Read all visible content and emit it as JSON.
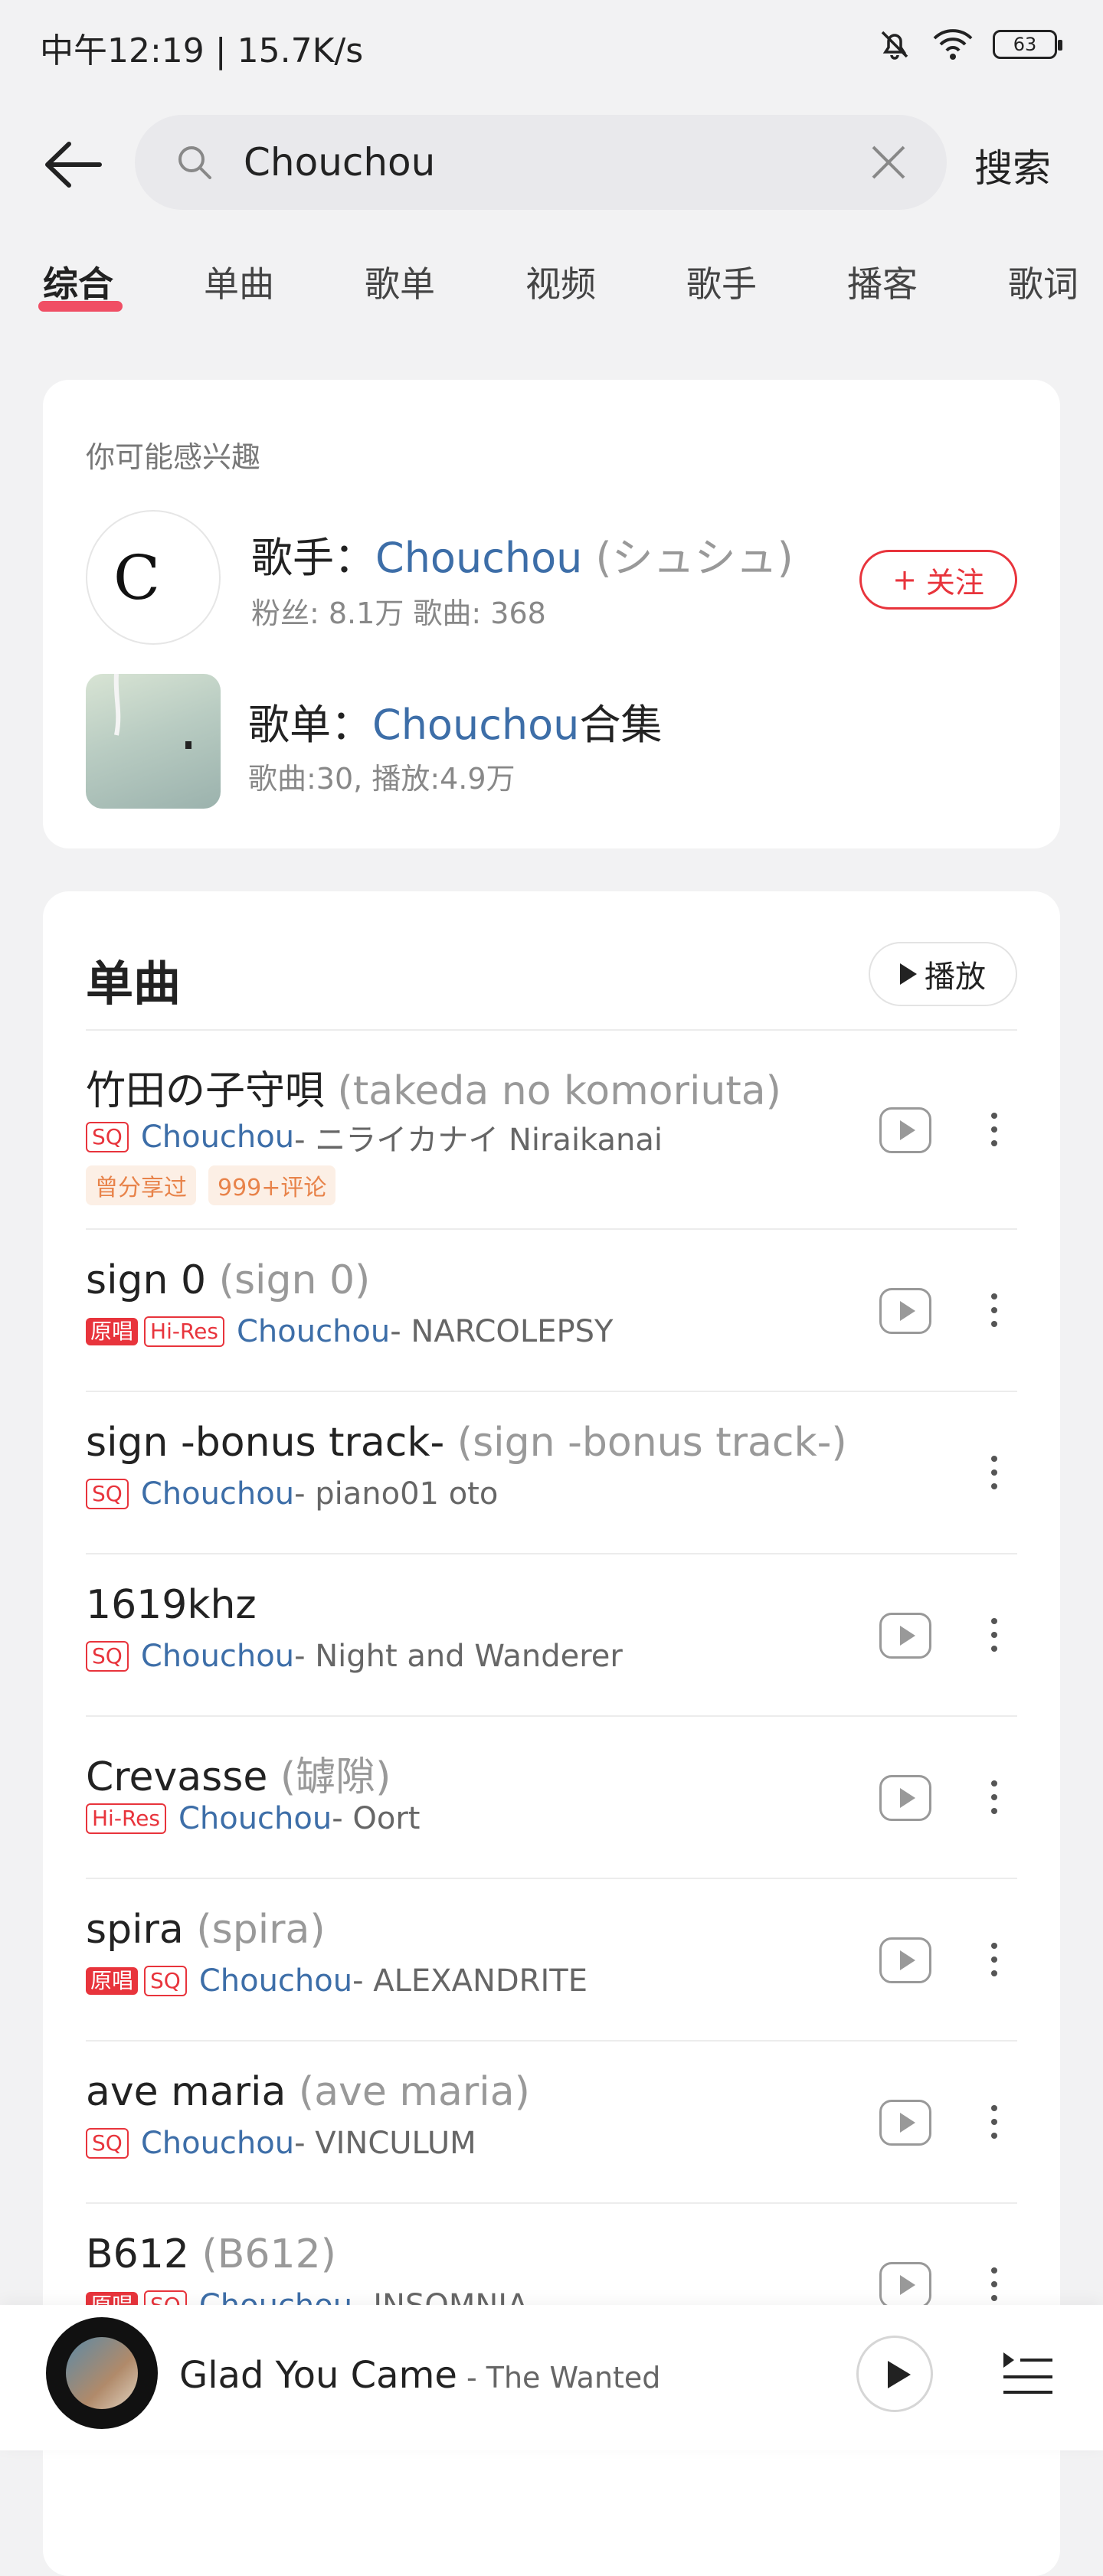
{
  "status": {
    "time": "中午12:19 | 15.7K/s",
    "battery": "63"
  },
  "search": {
    "query": "Chouchou",
    "button": "搜索"
  },
  "tabs": [
    "综合",
    "单曲",
    "歌单",
    "视频",
    "歌手",
    "播客",
    "歌词"
  ],
  "interest": {
    "label": "你可能感兴趣",
    "artist": {
      "prefix": "歌手：",
      "name": "Chouchou",
      "alias": " (シュシュ)",
      "stats": "粉丝: 8.1万  歌曲: 368",
      "follow": "关注",
      "avatar_letter": "C"
    },
    "playlist": {
      "prefix": "歌单：",
      "name": "Chouchou",
      "suffix": "合集",
      "stats": "歌曲:30, 播放:4.9万"
    }
  },
  "singles": {
    "heading": "单曲",
    "play_all": "播放",
    "songs": [
      {
        "title": "竹田の子守唄",
        "alt": " (takeda no komoriuta)",
        "badges": [
          "SQ"
        ],
        "artist": "Chouchou",
        "album": " - ニライカナイ Niraikanai",
        "tags": [
          "曾分享过",
          "999+评论"
        ]
      },
      {
        "title": "sign 0",
        "alt": " (sign 0)",
        "badges": [
          "原唱",
          "Hi-Res"
        ],
        "artist": "Chouchou",
        "album": " - NARCOLEPSY"
      },
      {
        "title": "sign -bonus track-",
        "alt": " (sign  -bonus track-)",
        "badges": [
          "SQ"
        ],
        "artist": "Chouchou",
        "album": " - piano01 oto"
      },
      {
        "title": "1619khz",
        "alt": "",
        "badges": [
          "SQ"
        ],
        "artist": "Chouchou",
        "album": " - Night and Wanderer"
      },
      {
        "title": "Crevasse",
        "alt": " (罅隙)",
        "badges": [
          "Hi-Res"
        ],
        "artist": "Chouchou",
        "album": " - Oort"
      },
      {
        "title": "spira",
        "alt": " (spira)",
        "badges": [
          "原唱",
          "SQ"
        ],
        "artist": "Chouchou",
        "album": " - ALEXANDRITE"
      },
      {
        "title": "ave maria",
        "alt": " (ave maria)",
        "badges": [
          "SQ"
        ],
        "artist": "Chouchou",
        "album": " - VINCULUM"
      },
      {
        "title": "B612",
        "alt": " (B612)",
        "badges": [
          "原唱",
          "SQ"
        ],
        "artist": "Chouchou",
        "album": " - INSOMNIA"
      }
    ]
  },
  "player": {
    "title": "Glad You Came",
    "artist": " - The Wanted"
  }
}
